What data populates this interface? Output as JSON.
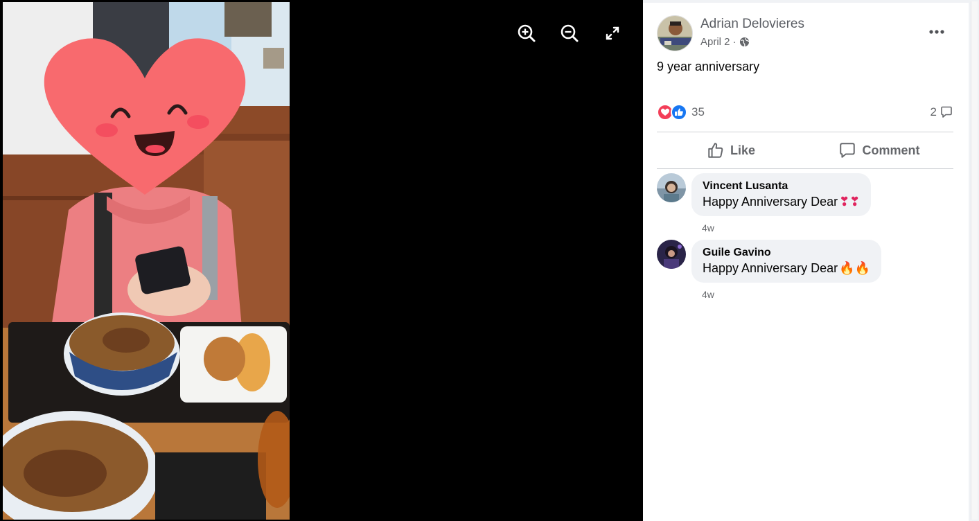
{
  "viewer": {
    "tools": [
      {
        "icon": "zoom-in-icon"
      },
      {
        "icon": "zoom-out-icon"
      },
      {
        "icon": "fullscreen-icon"
      }
    ]
  },
  "post": {
    "author": "Adrian Delovieres",
    "date": "April 2",
    "separator": "·",
    "privacy_icon": "globe-icon",
    "caption": "9 year anniversary",
    "reaction_count": "35",
    "comment_count": "2",
    "actions": {
      "like": "Like",
      "comment": "Comment"
    }
  },
  "comments": [
    {
      "name": "Vincent Lusanta",
      "text": "Happy Anniversary Dear",
      "emoji": "❣❣",
      "time": "4w"
    },
    {
      "name": "Guile Gavino",
      "text": "Happy Anniversary Dear",
      "emoji": "🔥🔥",
      "time": "4w"
    }
  ],
  "colors": {
    "love": "#f33e58",
    "like": "#1877f2",
    "secondary_text": "#65676b",
    "bubble": "#f0f2f5"
  }
}
